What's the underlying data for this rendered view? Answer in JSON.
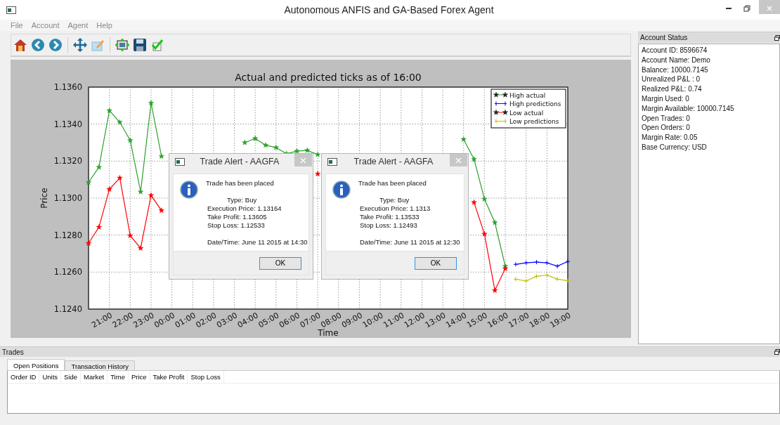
{
  "window": {
    "title": "Autonomous ANFIS and GA-Based Forex Agent"
  },
  "menu": [
    "File",
    "Account",
    "Agent",
    "Help"
  ],
  "chart": {
    "chart_data": {
      "type": "line",
      "title": "Actual and predicted ticks as of 16:00",
      "xlabel": "Time",
      "ylabel": "Price",
      "categories": [
        null,
        null,
        "21:00",
        null,
        "22:00",
        null,
        "23:00",
        null,
        "00:00",
        null,
        "01:00",
        null,
        "02:00",
        null,
        "03:00",
        null,
        "04:00",
        null,
        "05:00",
        null,
        "06:00",
        null,
        "07:00",
        null,
        "08:00",
        null,
        "09:00",
        null,
        "10:00",
        null,
        "11:00",
        null,
        "12:00",
        null,
        "13:00",
        null,
        "14:00",
        null,
        "15:00",
        null,
        "16:00",
        null,
        "17:00",
        null,
        "18:00",
        null,
        "19:00"
      ],
      "ylim": [
        1.124,
        1.136
      ],
      "grid": true,
      "legend": true,
      "yticks": [
        {
          "value": 1.124,
          "label": "1.1240"
        },
        {
          "value": 1.126,
          "label": "1.1260"
        },
        {
          "value": 1.128,
          "label": "1.1280"
        },
        {
          "value": 1.13,
          "label": "1.1300"
        },
        {
          "value": 1.132,
          "label": "1.1320"
        },
        {
          "value": 1.134,
          "label": "1.1340"
        },
        {
          "value": 1.136,
          "label": "1.1360"
        }
      ],
      "series": [
        {
          "name": "High actual",
          "color": "#2ca02c",
          "marker": "star",
          "values": [
            1.13085,
            1.13167,
            1.13473,
            1.1341,
            1.13312,
            1.13034,
            1.13514,
            1.13226,
            null,
            null,
            null,
            null,
            null,
            null,
            null,
            1.133,
            1.13322,
            1.13286,
            1.13273,
            1.1324,
            1.13254,
            1.13258,
            1.13235,
            null,
            null,
            null,
            null,
            null,
            null,
            null,
            null,
            null,
            null,
            null,
            null,
            null,
            1.13318,
            1.1321,
            1.12995,
            1.12868,
            1.12632,
            null,
            null,
            null,
            null,
            null,
            null
          ]
        },
        {
          "name": "High predictions",
          "color": "#0000ff",
          "marker": "plus",
          "values": [
            null,
            null,
            null,
            null,
            null,
            null,
            null,
            null,
            null,
            null,
            null,
            null,
            null,
            null,
            null,
            null,
            null,
            null,
            null,
            null,
            null,
            null,
            null,
            null,
            null,
            null,
            null,
            null,
            null,
            null,
            null,
            null,
            null,
            null,
            null,
            null,
            null,
            null,
            null,
            null,
            null,
            1.12642,
            1.1265,
            1.12654,
            1.1265,
            1.12632,
            1.12657
          ]
        },
        {
          "name": "Low actual",
          "color": "#ff0000",
          "marker": "star",
          "values": [
            1.12756,
            1.12843,
            1.13048,
            1.13109,
            1.12797,
            1.12729,
            1.13015,
            1.12933,
            null,
            null,
            null,
            null,
            null,
            null,
            null,
            null,
            null,
            null,
            null,
            null,
            null,
            null,
            1.13131,
            null,
            null,
            null,
            null,
            null,
            null,
            null,
            null,
            null,
            null,
            null,
            null,
            null,
            null,
            1.12977,
            1.12806,
            1.12501,
            1.12619,
            null,
            null,
            null,
            null,
            null,
            null
          ]
        },
        {
          "name": "Low predictions",
          "color": "#bfbf00",
          "marker": "plus",
          "values": [
            null,
            null,
            null,
            null,
            null,
            null,
            null,
            null,
            null,
            null,
            null,
            null,
            null,
            null,
            null,
            null,
            null,
            null,
            null,
            null,
            null,
            null,
            null,
            null,
            null,
            null,
            null,
            null,
            null,
            null,
            null,
            null,
            null,
            null,
            null,
            null,
            null,
            null,
            null,
            null,
            null,
            1.12562,
            1.12552,
            1.12577,
            1.12584,
            1.12562,
            1.12553
          ]
        }
      ]
    }
  },
  "dialogs": [
    {
      "title": "Trade Alert - AAGFA",
      "message": "Trade has been placed",
      "type": "Type: Buy",
      "details": [
        "Execution Price: 1.13164",
        "Take Profit: 1.13605",
        "Stop Loss: 1.12533"
      ],
      "datetime": "Date/Time: June 11 2015 at 14:30",
      "button": "OK"
    },
    {
      "title": "Trade Alert - AAGFA",
      "message": "Trade has been placed",
      "type": "Type: Buy",
      "details": [
        "Execution Price: 1.1313",
        "Take Profit: 1.13533",
        "Stop Loss: 1.12493"
      ],
      "datetime": "Date/Time: June 11 2015 at 12:30",
      "button": "OK"
    }
  ],
  "account_status": {
    "title": "Account Status",
    "lines": [
      "Account ID: 8596674",
      "Account Name: Demo",
      "Balance: 10000.7145",
      "Unrealized P&L : 0",
      "Realized P&L: 0.74",
      "Margin Used: 0",
      "Margin Available: 10000.7145",
      "Open Trades: 0",
      "Open Orders: 0",
      "Margin Rate: 0.05",
      "Base Currency: USD"
    ]
  },
  "trades": {
    "title": "Trades",
    "tabs": [
      {
        "label": "Open Positions",
        "selected": true
      },
      {
        "label": "Transaction History",
        "selected": false
      }
    ],
    "columns": [
      "Order ID",
      "Units",
      "Side",
      "Market",
      "Time",
      "Price",
      "Take Profit",
      "Stop Loss"
    ]
  }
}
